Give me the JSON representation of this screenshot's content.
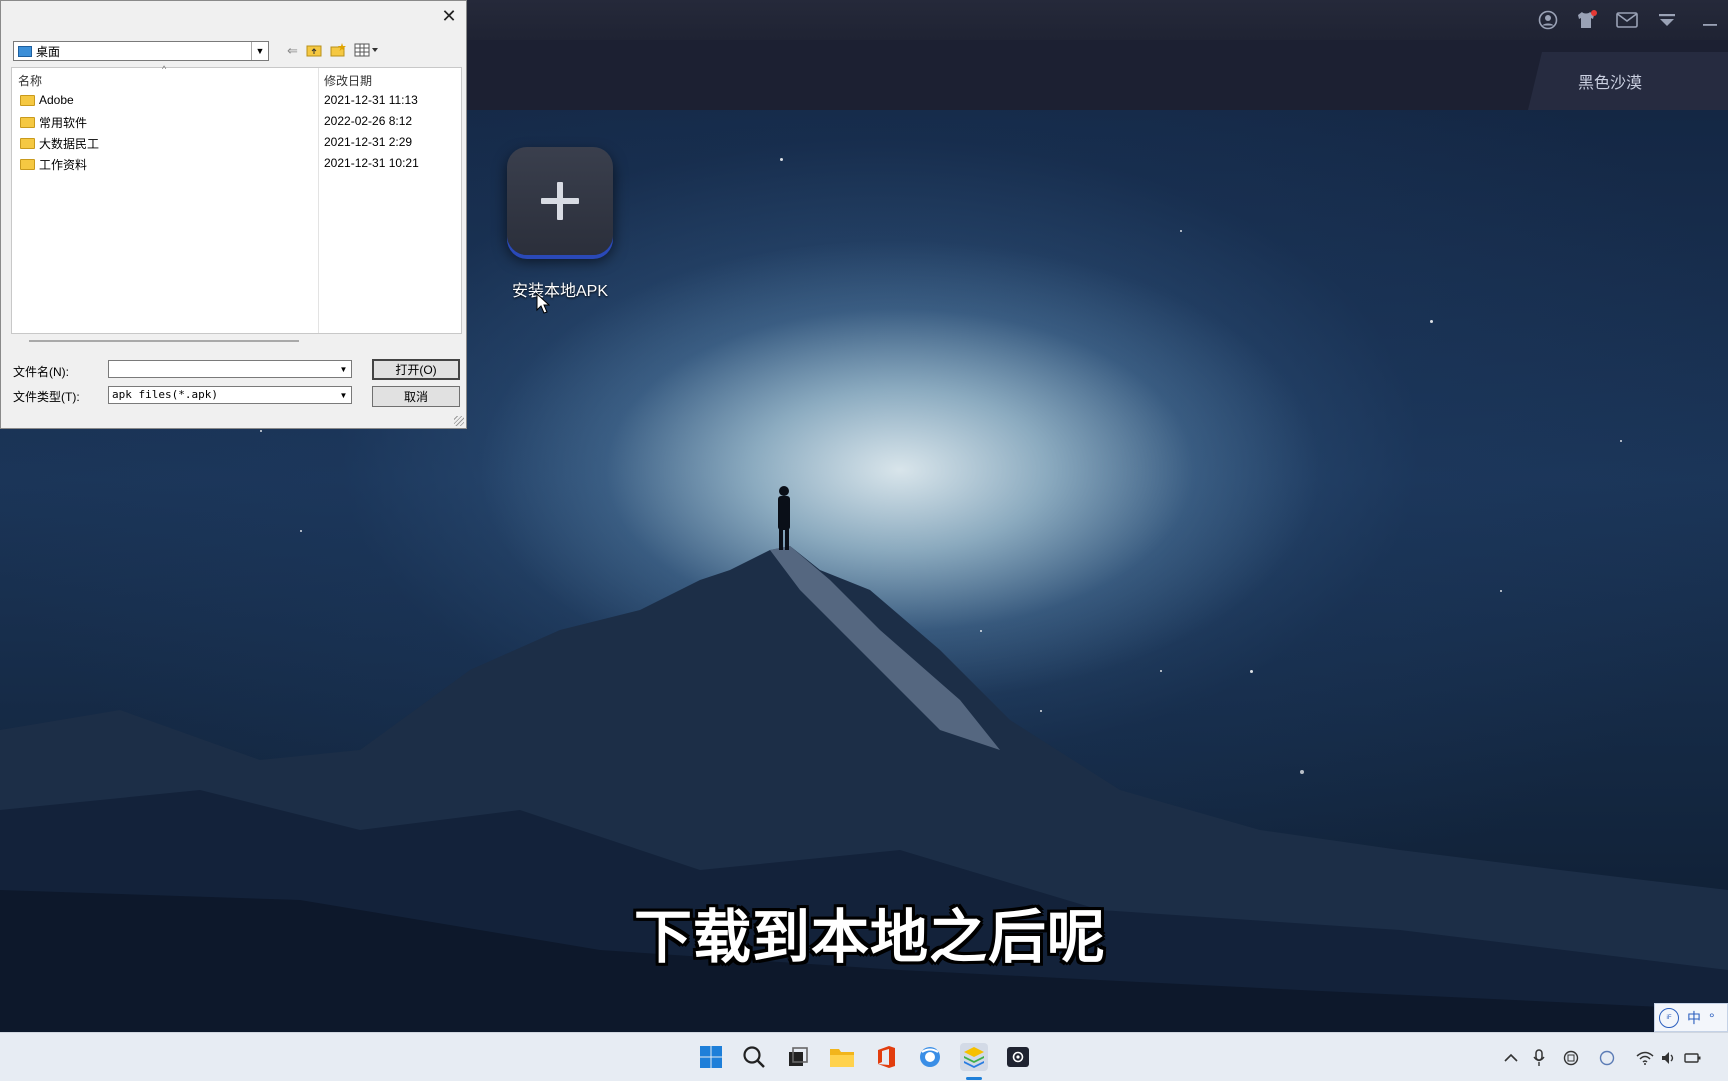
{
  "dialog": {
    "look_in": "桌面",
    "columns": {
      "name": "名称",
      "date": "修改日期"
    },
    "files": [
      {
        "name": "Adobe",
        "date": "2021-12-31 11:13"
      },
      {
        "name": "常用软件",
        "date": "2022-02-26 8:12"
      },
      {
        "name": "大数据民工",
        "date": "2021-12-31 2:29"
      },
      {
        "name": "工作资料",
        "date": "2021-12-31 10:21"
      }
    ],
    "filename_label": "文件名(N):",
    "filename_value": "",
    "filetype_label": "文件类型(T):",
    "filetype_value": "apk files(*.apk)",
    "open_button": "打开(O)",
    "cancel_button": "取消",
    "close_symbol": "✕"
  },
  "emulator": {
    "tab_label": "黑色沙漠",
    "install_apk_label": "安装本地APK"
  },
  "subtitle": "下载到本地之后呢",
  "ime": {
    "mode": "中",
    "symbol": "°"
  },
  "colors": {
    "dock_accent": "#2a49b8",
    "titlebar": "#25293a",
    "taskbar": "#e7ecf3",
    "notification_dot": "#e53935"
  }
}
